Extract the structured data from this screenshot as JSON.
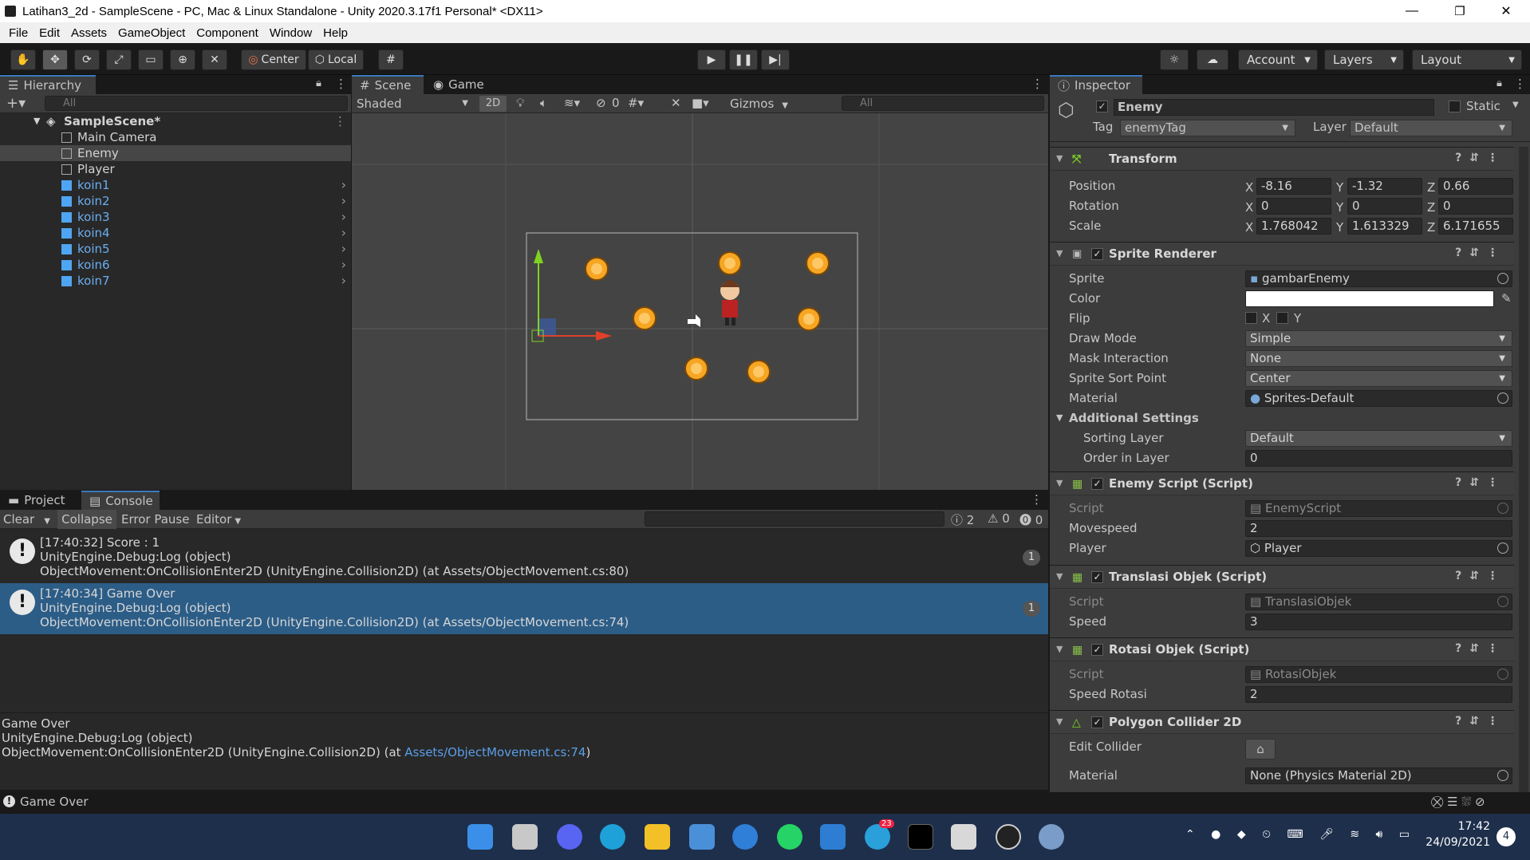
{
  "window": {
    "title": "Latihan3_2d - SampleScene - PC, Mac & Linux Standalone - Unity 2020.3.17f1 Personal* <DX11>",
    "minimize": "—",
    "restore": "❐",
    "close": "✕"
  },
  "menu": [
    "File",
    "Edit",
    "Assets",
    "GameObject",
    "Component",
    "Window",
    "Help"
  ],
  "toolbar": {
    "pivot": "Center",
    "space": "Local",
    "account": "Account",
    "layers": "Layers",
    "layout": "Layout"
  },
  "hierarchy": {
    "tab": "Hierarchy",
    "search_placeholder": "All",
    "scene": "SampleScene*",
    "items": [
      {
        "label": "Main Camera",
        "prefab": false
      },
      {
        "label": "Enemy",
        "prefab": false
      },
      {
        "label": "Player",
        "prefab": false
      },
      {
        "label": "koin1",
        "prefab": true
      },
      {
        "label": "koin2",
        "prefab": true
      },
      {
        "label": "koin3",
        "prefab": true
      },
      {
        "label": "koin4",
        "prefab": true
      },
      {
        "label": "koin5",
        "prefab": true
      },
      {
        "label": "koin6",
        "prefab": true
      },
      {
        "label": "koin7",
        "prefab": true
      }
    ]
  },
  "scene": {
    "tab_scene": "Scene",
    "tab_game": "Game",
    "shading": "Shaded",
    "mode2d": "2D",
    "hidden_count": "0",
    "gizmos": "Gizmos",
    "search_placeholder": "All"
  },
  "console": {
    "tab_project": "Project",
    "tab_console": "Console",
    "clear": "Clear",
    "collapse": "Collapse",
    "error_pause": "Error Pause",
    "editor": "Editor",
    "log_count": "2",
    "warn_count": "0",
    "error_count": "0",
    "entries": [
      {
        "line1": "[17:40:32] Score : 1",
        "line2": "UnityEngine.Debug:Log (object)",
        "line3": "ObjectMovement:OnCollisionEnter2D (UnityEngine.Collision2D) (at Assets/ObjectMovement.cs:80)",
        "count": "1"
      },
      {
        "line1": "[17:40:34] Game Over",
        "line2": "UnityEngine.Debug:Log (object)",
        "line3": "ObjectMovement:OnCollisionEnter2D (UnityEngine.Collision2D) (at Assets/ObjectMovement.cs:74)",
        "count": "1"
      }
    ],
    "detail": {
      "line1": "Game Over",
      "line2": "UnityEngine.Debug:Log (object)",
      "line3_prefix": "ObjectMovement:OnCollisionEnter2D (UnityEngine.Collision2D) (at ",
      "link": "Assets/ObjectMovement.cs:74",
      "line3_suffix": ")"
    }
  },
  "statusbar": {
    "message": "Game Over"
  },
  "inspector": {
    "tab": "Inspector",
    "object_name": "Enemy",
    "static_label": "Static",
    "tag_label": "Tag",
    "tag_value": "enemyTag",
    "layer_label": "Layer",
    "layer_value": "Default",
    "transform": {
      "title": "Transform",
      "position_label": "Position",
      "pos": {
        "x": "-8.16",
        "y": "-1.32",
        "z": "0.66"
      },
      "rotation_label": "Rotation",
      "rot": {
        "x": "0",
        "y": "0",
        "z": "0"
      },
      "scale_label": "Scale",
      "scale": {
        "x": "1.768042",
        "y": "1.613329",
        "z": "6.171655"
      }
    },
    "sprite_renderer": {
      "title": "Sprite Renderer",
      "sprite_label": "Sprite",
      "sprite": "gambarEnemy",
      "color_label": "Color",
      "color": "#ffffff",
      "flip_label": "Flip",
      "flip_x": "X",
      "flip_y": "Y",
      "draw_mode_label": "Draw Mode",
      "draw_mode": "Simple",
      "mask_label": "Mask Interaction",
      "mask": "None",
      "sort_point_label": "Sprite Sort Point",
      "sort_point": "Center",
      "material_label": "Material",
      "material": "Sprites-Default",
      "additional": "Additional Settings",
      "sorting_layer_label": "Sorting Layer",
      "sorting_layer": "Default",
      "order_label": "Order in Layer",
      "order": "0"
    },
    "enemy_script": {
      "title": "Enemy Script (Script)",
      "script_label": "Script",
      "script": "EnemyScript",
      "movespeed_label": "Movespeed",
      "movespeed": "2",
      "player_label": "Player",
      "player": "Player"
    },
    "translasi": {
      "title": "Translasi Objek (Script)",
      "script_label": "Script",
      "script": "TranslasiObjek",
      "speed_label": "Speed",
      "speed": "3"
    },
    "rotasi": {
      "title": "Rotasi Objek (Script)",
      "script_label": "Script",
      "script": "RotasiObjek",
      "speed_label": "Speed Rotasi",
      "speed": "2"
    },
    "polygon": {
      "title": "Polygon Collider 2D",
      "edit_label": "Edit Collider",
      "material_label": "Material",
      "material": "None (Physics Material 2D)"
    }
  },
  "taskbar": {
    "time": "17:42",
    "date": "24/09/2021",
    "telegram_badge": "23",
    "notif": "4"
  }
}
